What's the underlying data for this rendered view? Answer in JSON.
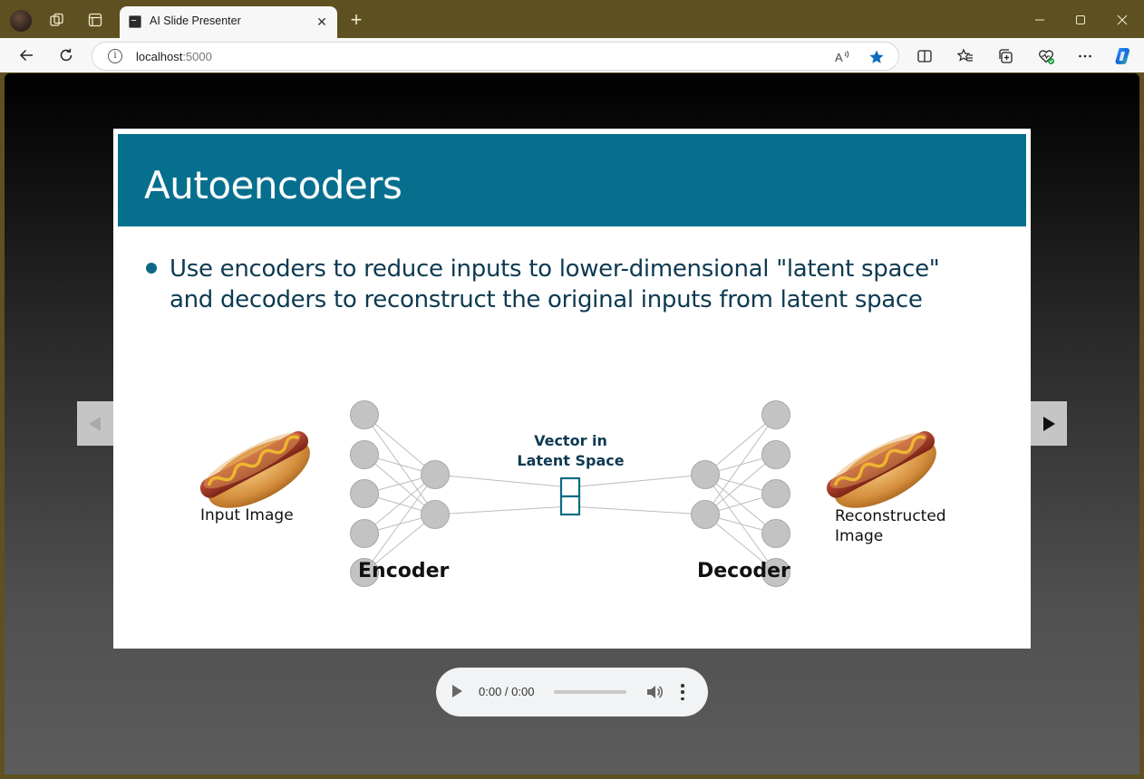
{
  "browser": {
    "tab_title": "AI Slide Presenter",
    "address_host": "localhost",
    "address_port": ":5000",
    "icons": [
      "profile-avatar-icon",
      "workspaces-icon",
      "tab-actions-icon",
      "terminal-favicon-icon",
      "close-icon",
      "new-tab-icon",
      "minimize-icon",
      "maximize-icon",
      "window-close-icon",
      "back-icon",
      "refresh-icon",
      "info-icon",
      "read-aloud-icon",
      "favorite-star-icon",
      "split-screen-icon",
      "favorites-icon",
      "collections-icon",
      "browser-essentials-icon",
      "more-icon",
      "copilot-icon"
    ],
    "accent": "#0f6cbd",
    "frame_color": "#5e5021"
  },
  "slide": {
    "title": "Autoencoders",
    "bullet": "Use encoders to reduce inputs to lower-dimensional \"latent space\" and decoders to reconstruct the original inputs from latent space",
    "header_color": "#066f8e",
    "diagram": {
      "input_label": "Input Image",
      "latent_label_line1": "Vector in",
      "latent_label_line2": "Latent Space",
      "encoder_label": "Encoder",
      "decoder_label": "Decoder",
      "output_label_line1": "Reconstructed",
      "output_label_line2": "Image"
    }
  },
  "controls": {
    "prev_icon": "triangle-left-icon",
    "next_icon": "triangle-right-icon"
  },
  "audio": {
    "time": "0:00 / 0:00"
  }
}
